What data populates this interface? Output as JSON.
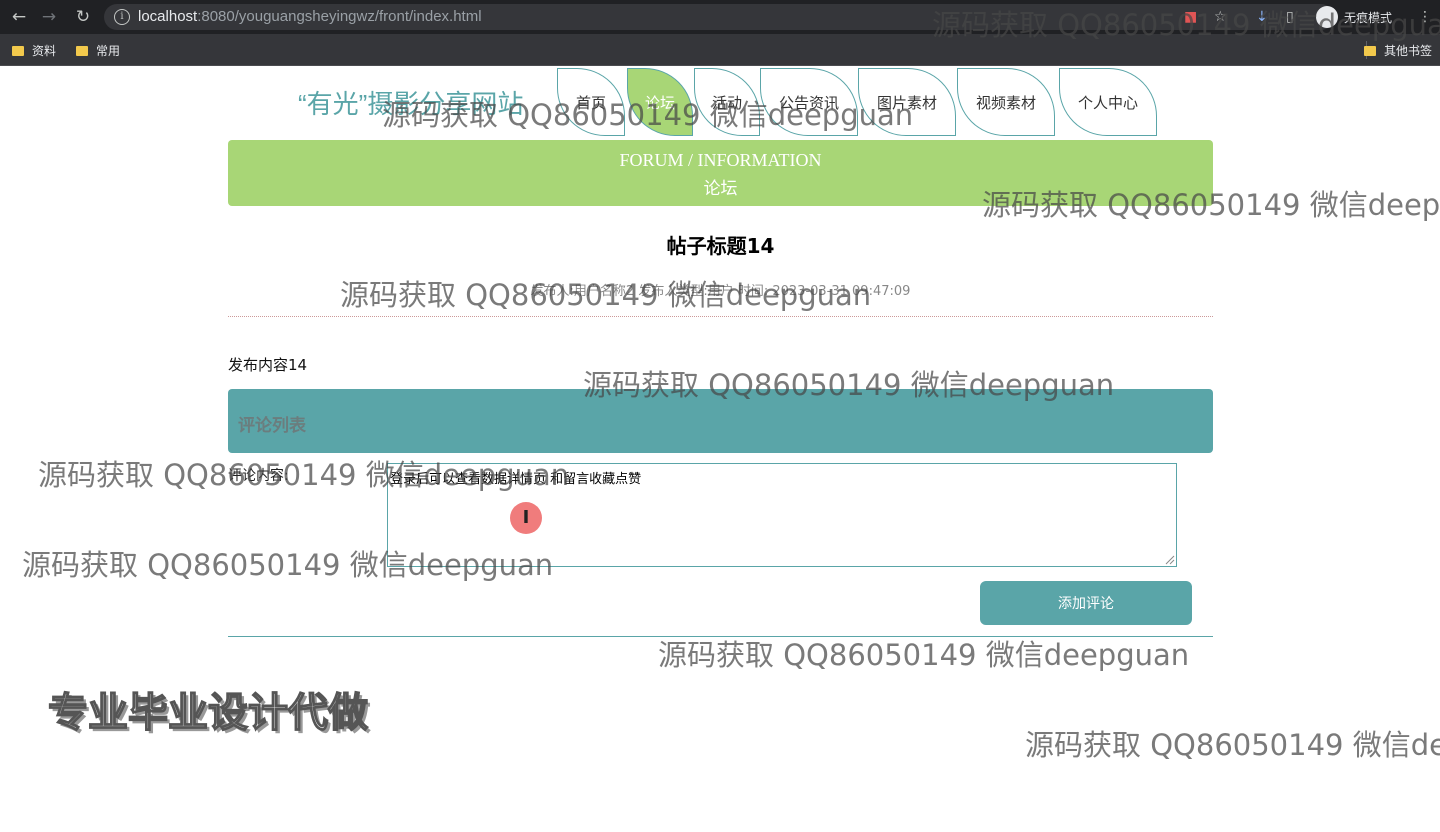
{
  "browser": {
    "url_host": "localhost",
    "url_rest": ":8080/youguangsheyingwz/front/index.html",
    "profile_label": "无痕模式",
    "bookmarks": [
      "资料",
      "常用"
    ],
    "other_bookmarks": "其他书签"
  },
  "site": {
    "logo": "“有光”摄影分享网站",
    "nav": [
      {
        "label": "首页",
        "active": false
      },
      {
        "label": "论坛",
        "active": true
      },
      {
        "label": "活动",
        "active": false
      },
      {
        "label": "公告资讯",
        "active": false
      },
      {
        "label": "图片素材",
        "active": false
      },
      {
        "label": "视频素材",
        "active": false
      },
      {
        "label": "个人中心",
        "active": false
      }
    ]
  },
  "banner": {
    "en": "FORUM / INFORMATION",
    "cn": "论坛"
  },
  "post": {
    "title": "帖子标题14",
    "meta": "发布人:用户名称2  发布人类型:用户  时间: 2023-03-31 09:47:09",
    "content": "发布内容14"
  },
  "comments": {
    "header": "评论列表",
    "label": "评论内容:",
    "value": "登录后可以查看数据详情页 和留言收藏点赞",
    "submit": "添加评论"
  },
  "overlays": {
    "watermark": "源码获取 QQ86050149 微信deepguan",
    "promo": "专业毕业设计代做"
  },
  "colors": {
    "accent": "#5aa5a8",
    "banner": "#a8d676"
  }
}
